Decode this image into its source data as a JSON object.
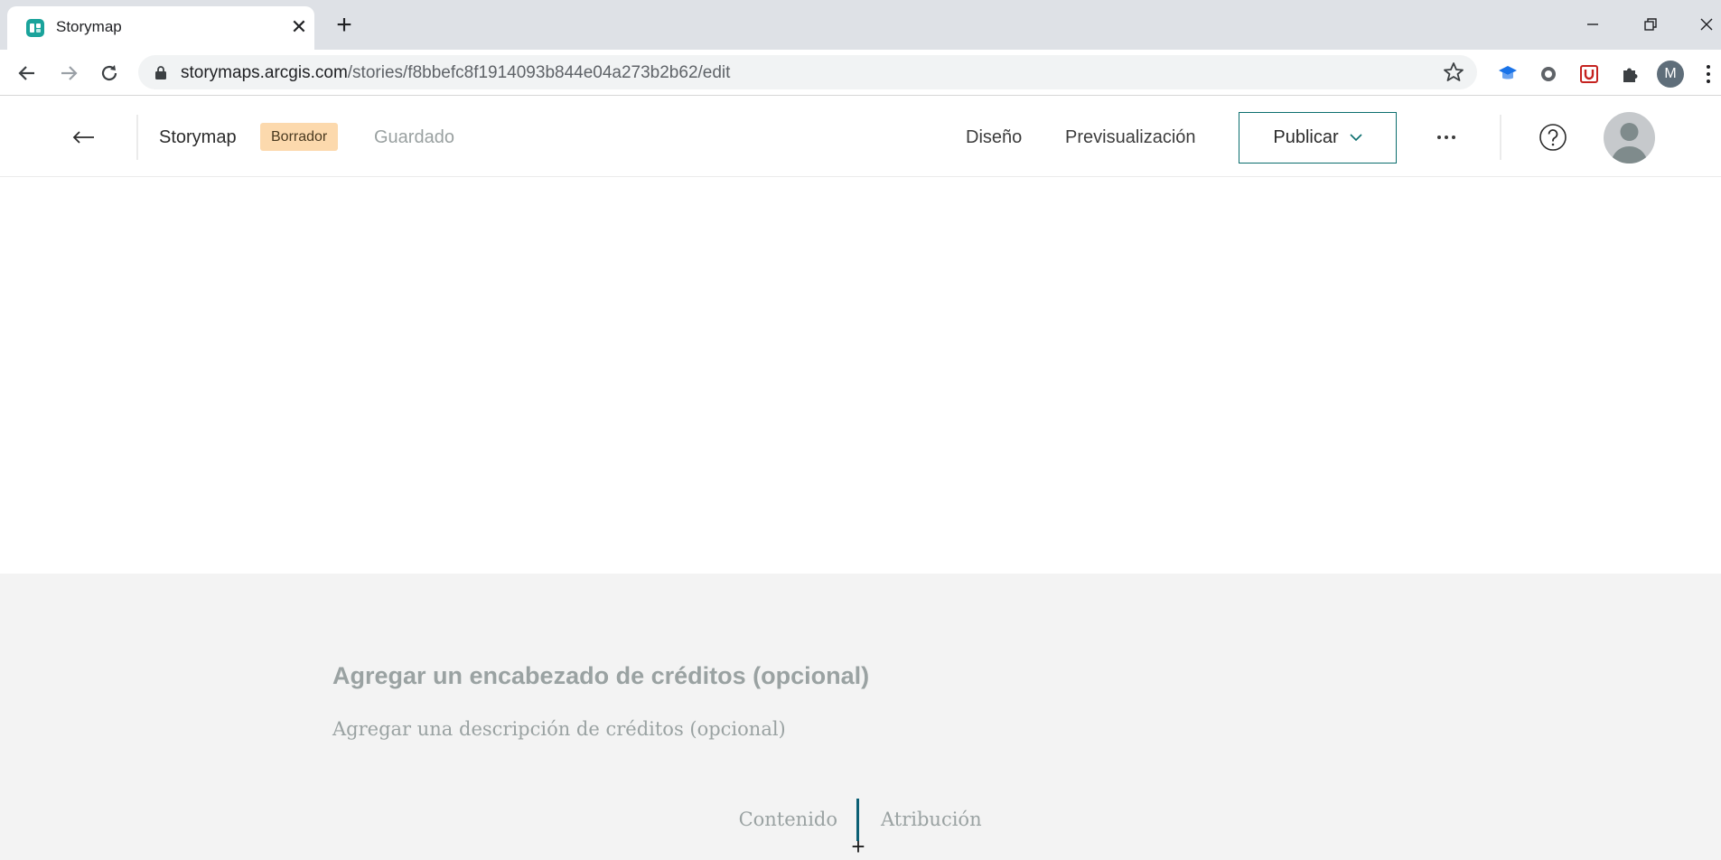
{
  "browser": {
    "tab_title": "Storymap",
    "tab_close": "✕",
    "new_tab": "+",
    "url_host": "storymaps.arcgis.com",
    "url_path": "/stories/f8bbefc8f1914093b844e04a273b2b62/edit",
    "profile_initial": "M"
  },
  "header": {
    "story_title": "Storymap",
    "draft_badge": "Borrador",
    "saved_status": "Guardado",
    "design_link": "Diseño",
    "preview_link": "Previsualización",
    "publish_label": "Publicar"
  },
  "credits": {
    "heading_placeholder": "Agregar un encabezado de créditos (opcional)",
    "description_placeholder": "Agregar una descripción de créditos (opcional)",
    "content_column": "Contenido",
    "attribution_column": "Atribución",
    "add_symbol": "+"
  },
  "colors": {
    "accent": "#0b6e6e",
    "draft_badge_bg": "#fcd9ad",
    "credits_bg": "#f3f3f3",
    "placeholder_text": "#9aa2a2"
  },
  "icons": [
    "storymaps-favicon",
    "close-icon",
    "plus-icon",
    "minimize-icon",
    "restore-icon",
    "window-close-icon",
    "back-icon",
    "forward-icon",
    "reload-icon",
    "lock-icon",
    "star-icon",
    "extension-icons",
    "puzzle-icon",
    "kebab-icon",
    "arrow-left-icon",
    "chevron-down-icon",
    "ellipsis-icon",
    "help-icon",
    "user-avatar-icon"
  ]
}
